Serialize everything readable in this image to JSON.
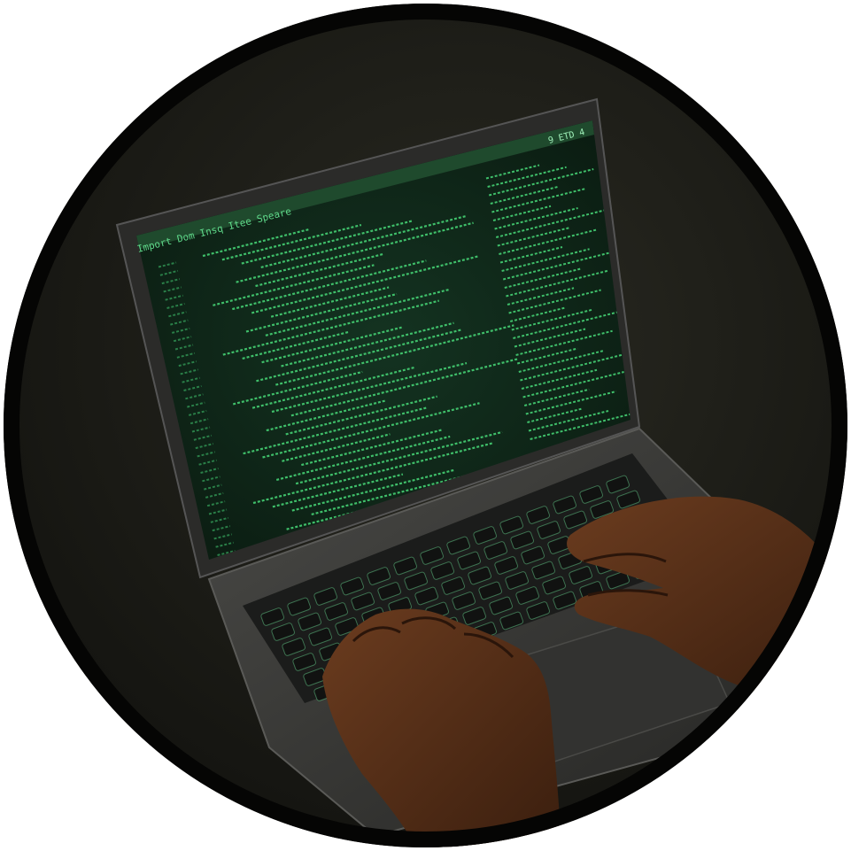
{
  "scene": {
    "subject": "hands typing on laptop with code editor",
    "colors": {
      "background": "#1a1a15",
      "screen_bg": "#0e1f14",
      "code_text": "#3fbf6a",
      "code_dim": "#2a7f48",
      "laptop_body": "#3a3a38",
      "keyboard": "#1b1c1b",
      "key_glow": "#6fe39a",
      "skin": "#5a3219"
    }
  },
  "screen": {
    "menu": [
      "Import",
      "Dom",
      "Insq",
      "Itee",
      "Speare"
    ],
    "status": [
      "9",
      "ETD",
      "4"
    ]
  }
}
